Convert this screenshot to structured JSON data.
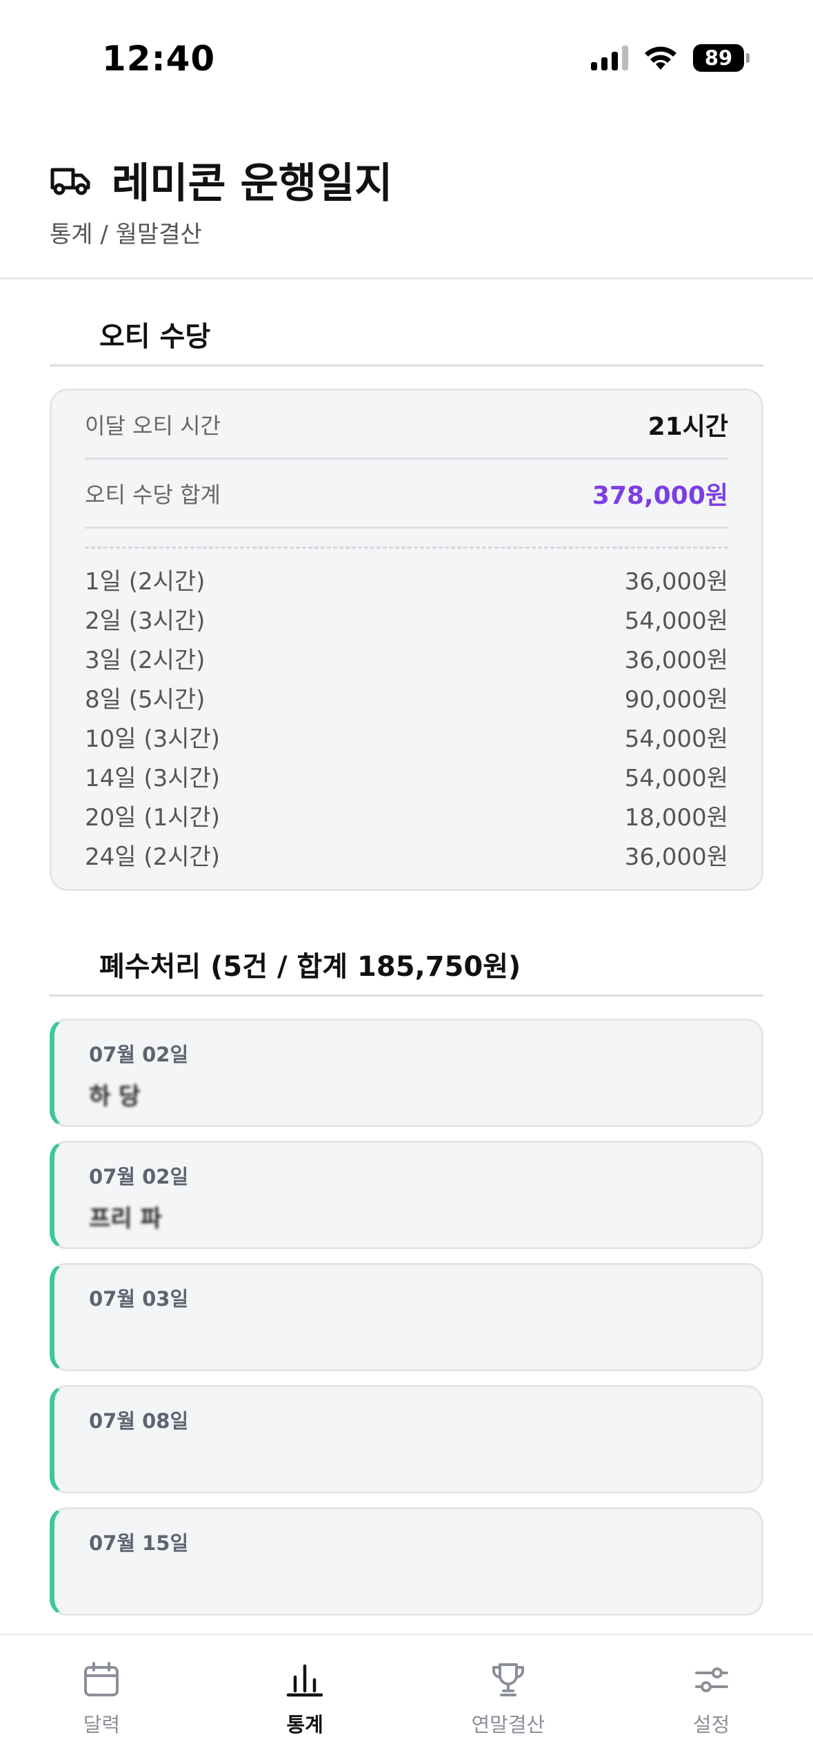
{
  "status_bar": {
    "time": "12:40",
    "battery": "89"
  },
  "header": {
    "title": "레미콘 운행일지",
    "breadcrumb": "통계 / 월말결산"
  },
  "overtime": {
    "section_title": "오티 수당",
    "hours_label": "이달 오티 시간",
    "hours_value": "21시간",
    "total_label": "오티 수당 합계",
    "total_value": "378,000원",
    "items": [
      {
        "day": "1일 (2시간)",
        "amount": "36,000원"
      },
      {
        "day": "2일 (3시간)",
        "amount": "54,000원"
      },
      {
        "day": "3일 (2시간)",
        "amount": "36,000원"
      },
      {
        "day": "8일 (5시간)",
        "amount": "90,000원"
      },
      {
        "day": "10일 (3시간)",
        "amount": "54,000원"
      },
      {
        "day": "14일 (3시간)",
        "amount": "54,000원"
      },
      {
        "day": "20일 (1시간)",
        "amount": "18,000원"
      },
      {
        "day": "24일 (2시간)",
        "amount": "36,000원"
      }
    ]
  },
  "waste": {
    "section_title": "폐수처리 (5건 / 합계 185,750원)",
    "entries": [
      {
        "date": "07월 02일",
        "desc": "하 당"
      },
      {
        "date": "07월 02일",
        "desc": "프리 파"
      },
      {
        "date": "07월 03일",
        "desc": ""
      },
      {
        "date": "07월 08일",
        "desc": ""
      },
      {
        "date": "07월 15일",
        "desc": ""
      }
    ]
  },
  "nav": {
    "items": [
      {
        "label": "달력",
        "icon": "calendar-icon"
      },
      {
        "label": "통계",
        "icon": "bar-chart-icon",
        "active": true
      },
      {
        "label": "연말결산",
        "icon": "trophy-icon"
      },
      {
        "label": "설정",
        "icon": "sliders-icon"
      }
    ]
  },
  "colors": {
    "accent_purple": "#7b3fe4",
    "accent_green": "#3cc79d"
  }
}
